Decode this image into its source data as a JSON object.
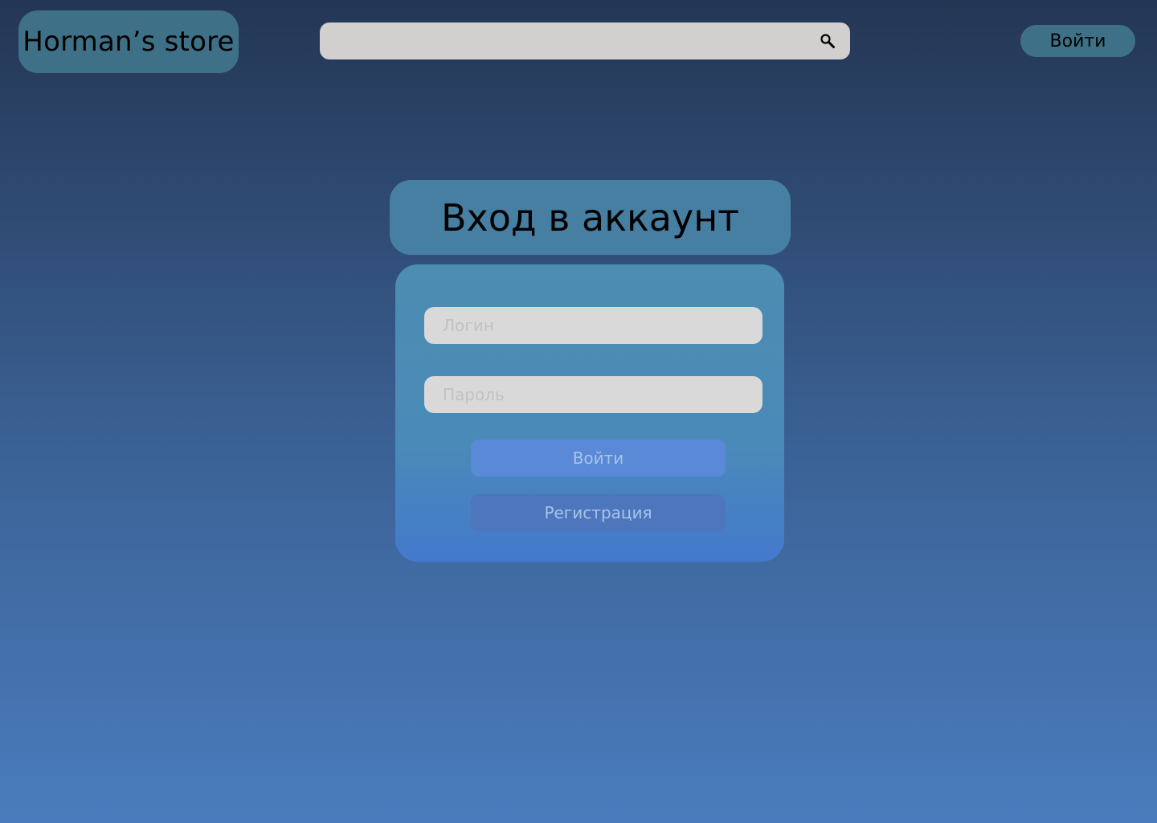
{
  "header": {
    "logo_text": "Horman’s store",
    "search": {
      "value": "",
      "placeholder": ""
    },
    "search_icon": "search-icon",
    "login_label": "Войти"
  },
  "login": {
    "title": "Вход в аккаунт",
    "login_field": {
      "value": "",
      "placeholder": "Логин"
    },
    "password_field": {
      "value": "",
      "placeholder": "Пароль"
    },
    "submit_label": "Войти",
    "register_label": "Регистрация"
  },
  "colors": {
    "background_top": "#243654",
    "background_bottom": "#4a7cbd",
    "accent_teal": "#3e7187",
    "title_card": "#477fa3",
    "button_login": "#5a89d8",
    "button_register": "#4d76bd",
    "field": "#d9d9d9",
    "search": "#d2cfcf"
  }
}
